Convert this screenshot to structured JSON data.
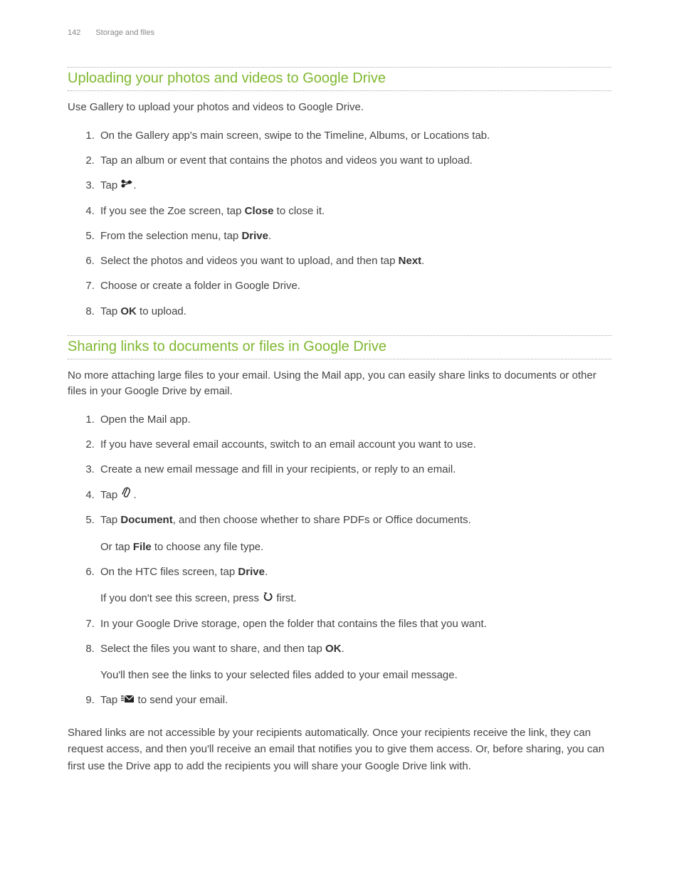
{
  "header": {
    "page_number": "142",
    "section_name": "Storage and files"
  },
  "section1": {
    "title": "Uploading your photos and videos to Google Drive",
    "intro": "Use Gallery to upload your photos and videos to Google Drive.",
    "steps": {
      "s1": "On the Gallery app's main screen, swipe to the Timeline, Albums, or Locations tab.",
      "s2": "Tap an album or event that contains the photos and videos you want to upload.",
      "s3_pre": "Tap ",
      "s3_post": ".",
      "s4_pre": "If you see the Zoe screen, tap ",
      "s4_bold": "Close",
      "s4_post": " to close it.",
      "s5_pre": "From the selection menu, tap ",
      "s5_bold": "Drive",
      "s5_post": ".",
      "s6_pre": "Select the photos and videos you want to upload, and then tap ",
      "s6_bold": "Next",
      "s6_post": ".",
      "s7": "Choose or create a folder in Google Drive.",
      "s8_pre": "Tap ",
      "s8_bold": "OK",
      "s8_post": " to upload."
    }
  },
  "section2": {
    "title": "Sharing links to documents or files in Google Drive",
    "intro": "No more attaching large files to your email. Using the Mail app, you can easily share links to documents or other files in your Google Drive by email.",
    "steps": {
      "s1": "Open the Mail app.",
      "s2": "If you have several email accounts, switch to an email account you want to use.",
      "s3": "Create a new email message and fill in your recipients, or reply to an email.",
      "s4_pre": "Tap ",
      "s4_post": " .",
      "s5_pre": "Tap ",
      "s5_bold1": "Document",
      "s5_mid": ", and then choose whether to share PDFs or Office documents.",
      "s5_sub_pre": "Or tap ",
      "s5_sub_bold": "File",
      "s5_sub_post": " to choose any file type.",
      "s6_pre": "On the HTC files screen, tap ",
      "s6_bold": "Drive",
      "s6_post": ".",
      "s6_sub_pre": "If you don't see this screen, press ",
      "s6_sub_post": " first.",
      "s7": "In your Google Drive storage, open the folder that contains the files that you want.",
      "s8_pre": "Select the files you want to share, and then tap ",
      "s8_bold": "OK",
      "s8_post": ".",
      "s8_sub": "You'll then see the links to your selected files added to your email message.",
      "s9_pre": "Tap ",
      "s9_post": " to send your email."
    },
    "closing": "Shared links are not accessible by your recipients automatically. Once your recipients receive the link, they can request access, and then you'll receive an email that notifies you to give them access. Or, before sharing, you can first use the Drive app to add the recipients you will share your Google Drive link with."
  }
}
